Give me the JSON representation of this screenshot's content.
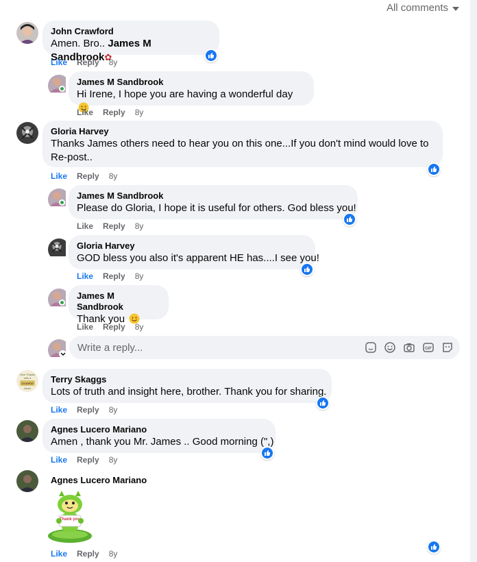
{
  "header": {
    "sort_label": "All comments"
  },
  "actions": {
    "like": "Like",
    "reply": "Reply"
  },
  "comments": [
    {
      "name": "John Crawford",
      "text_plain": "Amen. Bro.. ",
      "mention": "James M Sandbrook",
      "age": "8y"
    },
    {
      "name": "James M Sandbrook",
      "text": "Hi Irene, I hope you are having a wonderful day",
      "age": "8y"
    },
    {
      "name": "Gloria Harvey",
      "text_line1": "Thanks James others need to hear you on this one...If you don't mind would love to",
      "text_line2": "Re-post..",
      "age": "8y"
    },
    {
      "name": "James M Sandbrook",
      "text": "Please do Gloria, I hope it is useful for others. God bless you!",
      "age": "8y"
    },
    {
      "name": "Gloria Harvey",
      "text": "GOD bless you also it's apparent HE has....I see you!",
      "age": "8y"
    },
    {
      "name": "James M Sandbrook",
      "text": "Thank you",
      "age": "8y"
    },
    {
      "name": "Terry Skaggs",
      "text": "Lots of truth and insight here, brother. Thank you for sharing.",
      "age": "8y"
    },
    {
      "name": "Agnes Lucero Mariano",
      "text": "Amen , thank you Mr. James .. Good morning (\",)",
      "age": "8y"
    },
    {
      "name": "Agnes Lucero Mariano",
      "sticker": "thank-you-sticker",
      "sticker_text": "Thank you",
      "age": "8y"
    }
  ],
  "reply_box": {
    "placeholder": "Write a reply..."
  },
  "avatar_texts": {
    "terry": [
      "Give Thanks",
      "with a",
      "Grateful",
      "Heart"
    ]
  },
  "icons": {
    "reaction": "like-reaction-icon",
    "tools": [
      "sticker-icon",
      "emoji-icon",
      "camera-icon",
      "gif-icon",
      "avatar-sticker-icon"
    ]
  },
  "colors": {
    "accent": "#1877f2",
    "bubble": "#f0f2f5",
    "muted": "#65676b",
    "online": "#31a24c"
  }
}
